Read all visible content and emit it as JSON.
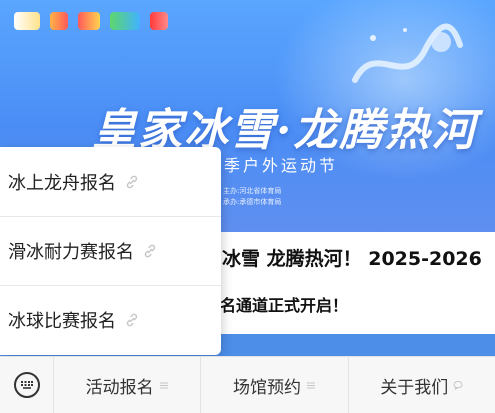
{
  "banner": {
    "title": "皇家冰雪·龙腾热河",
    "subtitle": "季户外运动节",
    "host_line1": "主办:河北省体育局",
    "host_line2": "承办:承德市体育局"
  },
  "article": {
    "headline": "冰雪  龙腾热河！ 2025-2026",
    "subline": "名通道正式开启！"
  },
  "popup_menu": {
    "items": [
      {
        "label": "冰上龙舟报名"
      },
      {
        "label": "滑冰耐力赛报名"
      },
      {
        "label": "冰球比赛报名"
      }
    ]
  },
  "bottom_menu": {
    "keyboard_icon": "keyboard-icon",
    "tabs": [
      {
        "label": "活动报名",
        "icon": "menu-lines-icon"
      },
      {
        "label": "场馆预约",
        "icon": "menu-lines-icon"
      },
      {
        "label": "关于我们",
        "icon": "chat-bubble-icon"
      }
    ]
  },
  "colors": {
    "banner_blue": "#4a8df5",
    "stripe_blue": "#4d8ee9",
    "menubar_bg": "#f7f7f7"
  }
}
